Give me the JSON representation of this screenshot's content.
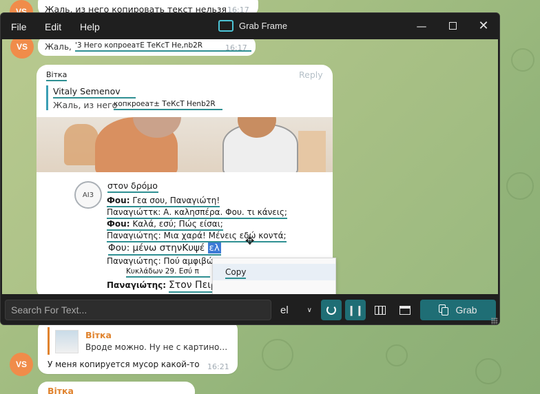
{
  "chat": {
    "top": {
      "avatar": "VS",
      "text": "Жаль, из него копировать текст нельзя",
      "time": "16:17"
    },
    "reply_label": "Reply",
    "bottom": {
      "quote_author": "Вiтка",
      "quote_text": "Вроде можно. Ну не с картино…",
      "avatar": "VS",
      "text": "У меня копируется мусор какой-то",
      "time": "16:21"
    },
    "peek_author": "Вiтка"
  },
  "window": {
    "title": "Grab Frame",
    "menu": [
      "File",
      "Edit",
      "Help"
    ]
  },
  "capture": {
    "row1": {
      "avatar": "VS",
      "prefix": "Жаль,",
      "ocr": "'3 Него копроеатЕ ТеКсТ Не,nb2R",
      "time": "16:17"
    },
    "sender": "Вiтка",
    "reply_label": "Reply",
    "quote_author": "Vitaly Semenov",
    "quote_prefix": "Жаль, из него",
    "quote_ocr": "копкроеат± ТеКсТ Henb2R",
    "sticker_badge": "AI3",
    "lines": [
      {
        "speaker": "Фоu:",
        "text": "Γεα σου, Παναγιώτη!"
      },
      {
        "speaker": "Παναγιώττκ:",
        "text": "Α. καλησπέρα. Φου. τι κάνεις;"
      },
      {
        "speaker": "Фоu:",
        "text": "Καλά, εσύ; Πώς είσαι;"
      },
      {
        "speaker": "Παναγιώτης:",
        "text": "Μια χαρά! Μένεις εδώ κοντά;"
      },
      {
        "speaker": "Φου:",
        "text": "μένω στηνΚυψέ",
        "highlight": "ελ"
      },
      {
        "speaker": "Παναγιώτης:",
        "text": "Πού αμφιβώ"
      },
      {
        "speaker": "",
        "text": "Κυκλάδων 29. Εσύ π"
      },
      {
        "speaker": "Παναγιώτης:",
        "text": "Στον Πειραι Edit Text"
      }
    ],
    "ocr_title": "στον δρόμο",
    "context_menu": [
      "Copy"
    ]
  },
  "toolbar": {
    "search_placeholder": "Search For Text...",
    "language": "el",
    "grab_label": "Grab"
  },
  "colors": {
    "accent": "#1f6e75",
    "underline": "#2e8f92",
    "avatar": "#f08c4a"
  }
}
